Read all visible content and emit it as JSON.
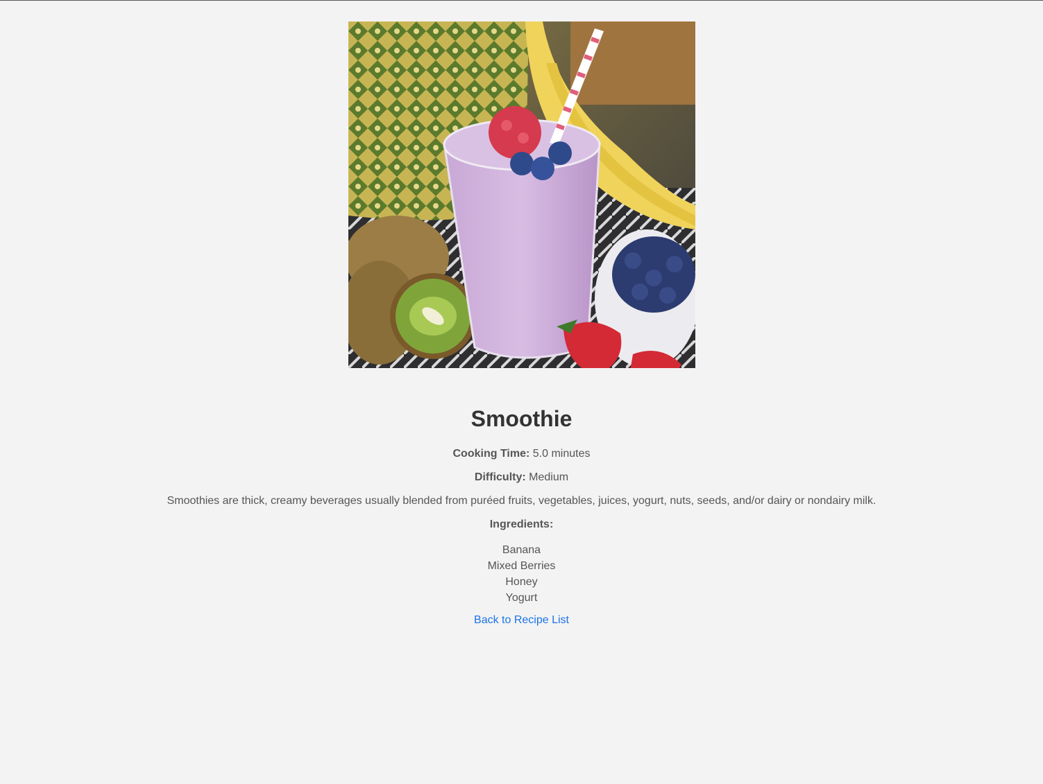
{
  "recipe": {
    "image_alt": "Smoothie",
    "title": "Smoothie",
    "cooking_time_label": "Cooking Time:",
    "cooking_time_value": "5.0 minutes",
    "difficulty_label": "Difficulty:",
    "difficulty_value": "Medium",
    "description": "Smoothies are thick, creamy beverages usually blended from puréed fruits, vegetables, juices, yogurt, nuts, seeds, and/or dairy or nondairy milk.",
    "ingredients_label": "Ingredients:",
    "ingredients": [
      "Banana",
      "Mixed Berries",
      "Honey",
      "Yogurt"
    ],
    "back_link": "Back to Recipe List"
  },
  "colors": {
    "background": "#f3f3f3",
    "text": "#555555",
    "title": "#333333",
    "link": "#1a73e8"
  }
}
